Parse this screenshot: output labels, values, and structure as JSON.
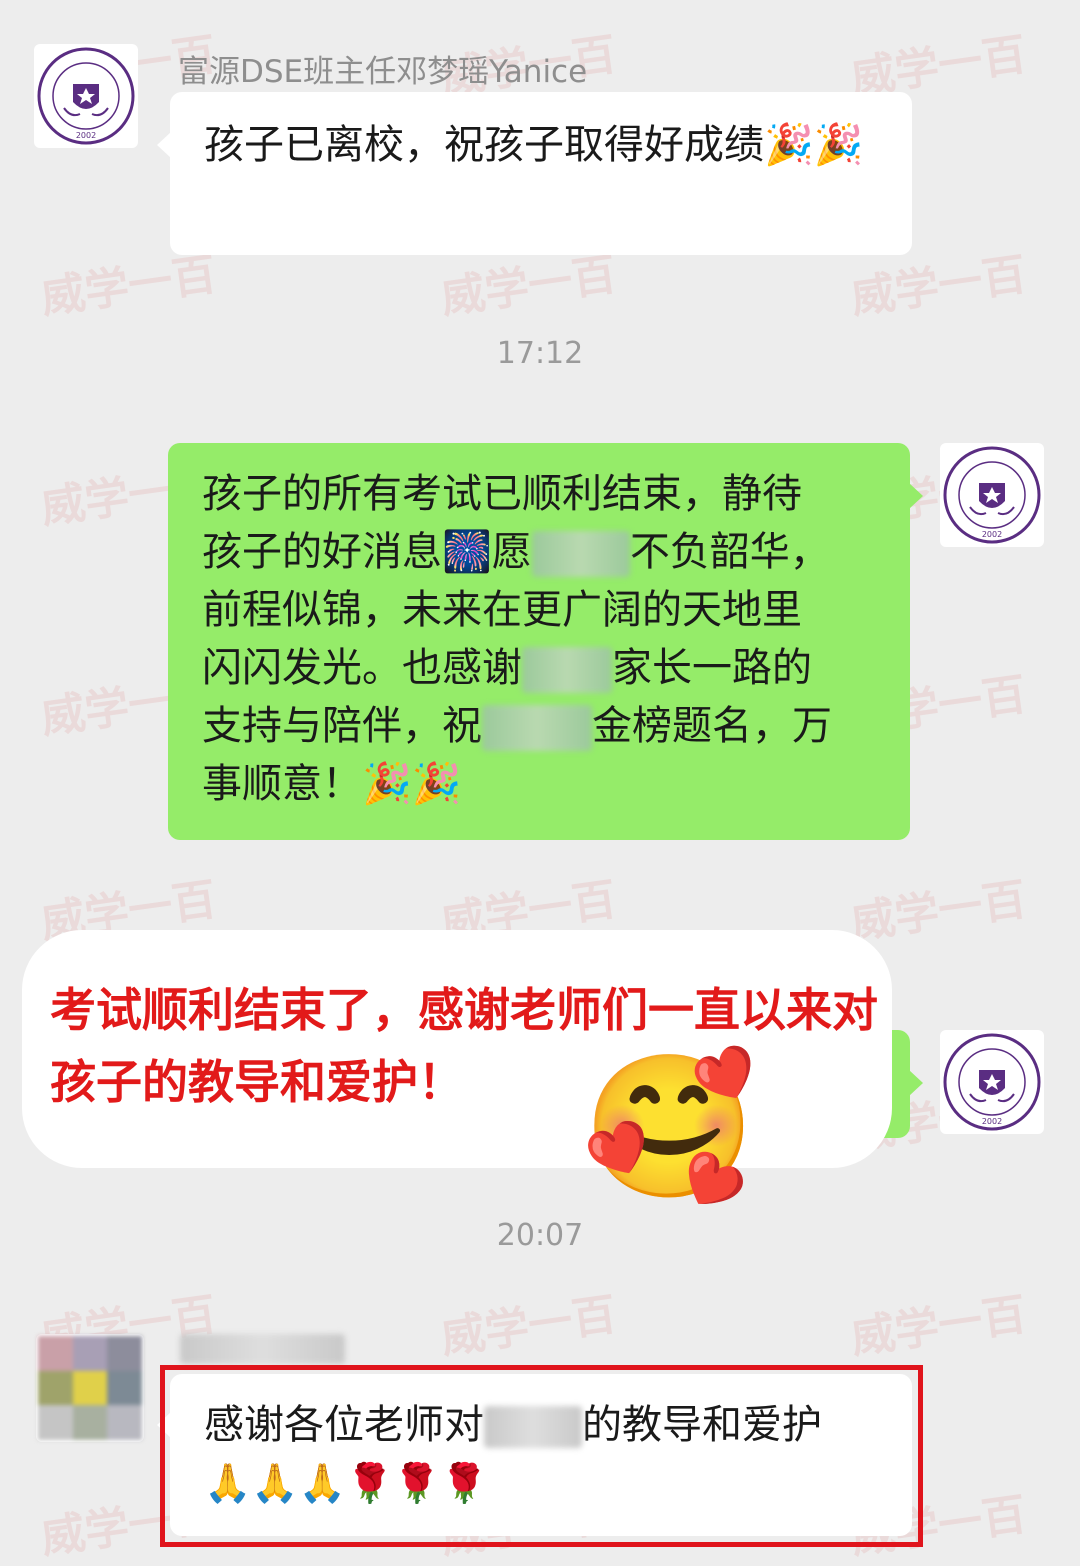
{
  "messages": [
    {
      "sender": "富源DSE班主任邓梦瑶Yanice",
      "text": "孩子已离校，祝孩子取得好成绩🎉🎉"
    },
    {
      "timestamp": "17:12"
    },
    {
      "direction": "outgoing",
      "lines": [
        "孩子的所有考试已顺利结束，静待",
        "孩子的好消息🎆愿",
        "不负韶华，",
        "前程似锦，未来在更广阔的天地里",
        "闪闪发光。也感谢",
        "家长一路的",
        "支持与陪伴，祝",
        "金榜题名，万",
        "事顺意！🎉🎉"
      ]
    },
    {
      "overlay_caption": "考试顺利结束了，感谢老师们一直以来对孩子的教导和爱护！",
      "emoji": "🥰"
    },
    {
      "timestamp": "20:07"
    },
    {
      "text_before": "感谢各位老师对",
      "text_after": "的教导和爱护",
      "emoji": "🙏🙏🙏🌹🌹🌹"
    }
  ],
  "avatar": {
    "school_text": "FUYUAN BRITISH AMERICAN SCHOOL",
    "year": "2002",
    "color": "#5a2d82"
  },
  "watermark": "威学一百",
  "colors": {
    "background": "#ededed",
    "outgoing_bubble": "#95ec69",
    "incoming_bubble": "#ffffff",
    "highlight": "#e0141c"
  }
}
